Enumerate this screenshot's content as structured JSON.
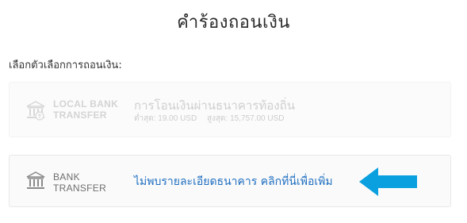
{
  "header": {
    "title": "คำร้องถอนเงิน"
  },
  "selection": {
    "prompt": "เลือกตัวเลือกการถอนเงิน:"
  },
  "methods": [
    {
      "bank_label_line1": "LOCAL BANK",
      "bank_label_line2": "TRANSFER",
      "name": "การโอนเงินผ่านธนาคารท้องถิ่น",
      "min": "ต่ำสุด: 19.00 USD",
      "max": "สูงสุด: 15,757.00 USD",
      "icon": "bank-icon",
      "state": "disabled"
    },
    {
      "bank_label_line1": "BANK",
      "bank_label_line2": "TRANSFER",
      "link_text": "ไม่พบรายละเอียดธนาคาร คลิกที่นี่เพื่อเพิ่ม",
      "icon": "bank-icon",
      "state": "active"
    }
  ],
  "annotation": {
    "icon": "arrow-left-icon",
    "color": "#0aa0e0"
  },
  "colors": {
    "link": "#1f6fc1",
    "disabled_text": "#cfcfcf"
  }
}
